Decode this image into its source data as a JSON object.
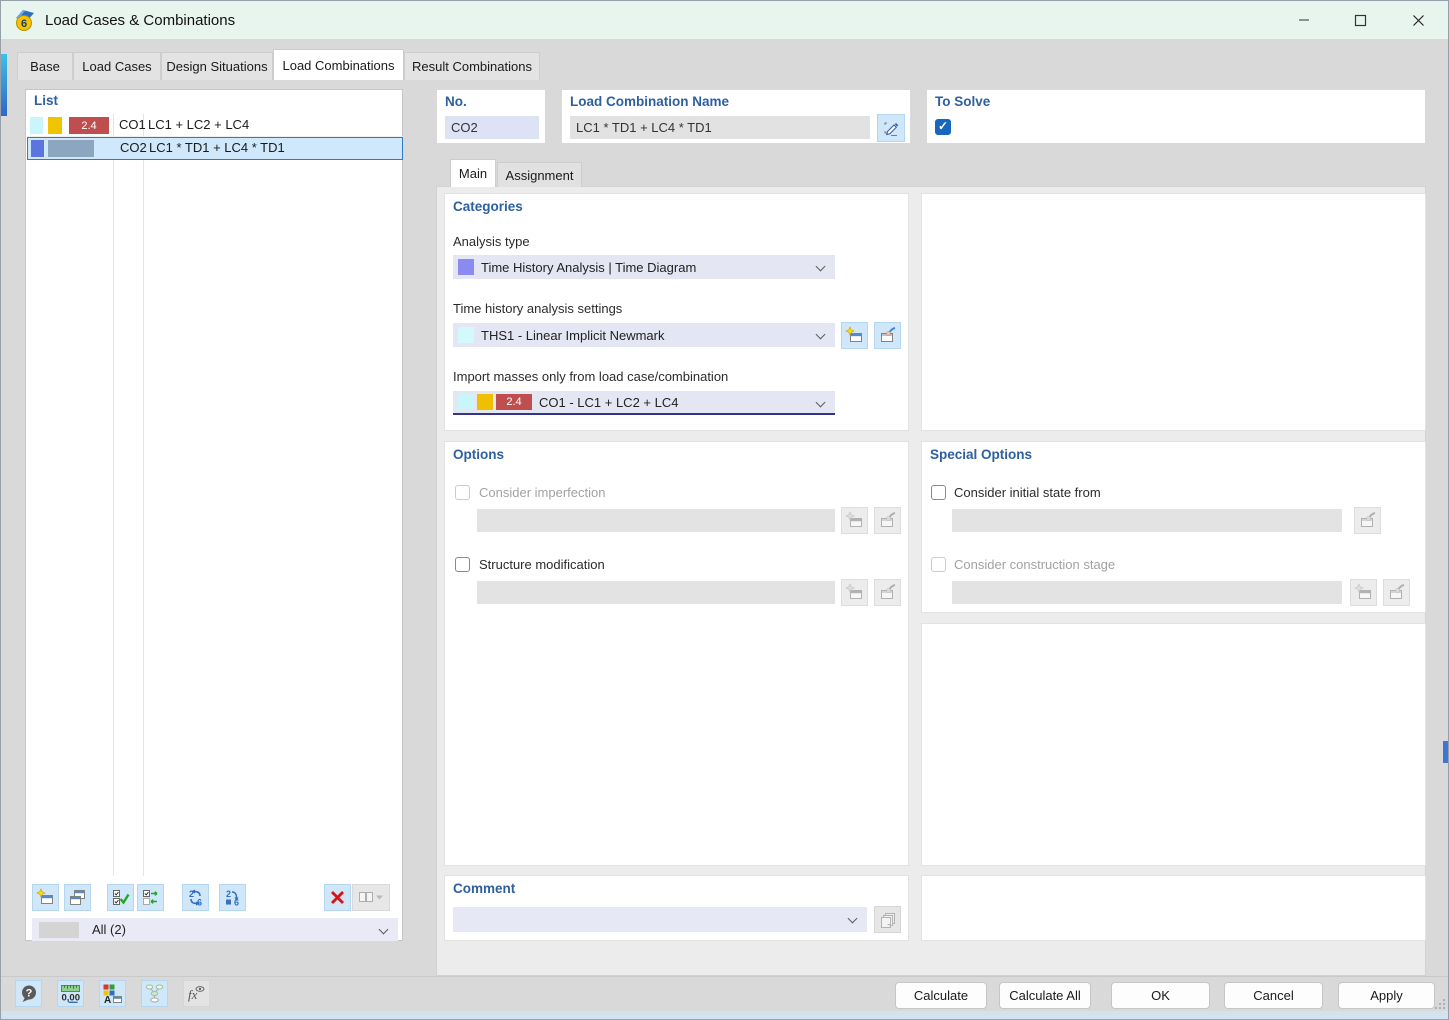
{
  "window": {
    "title": "Load Cases & Combinations"
  },
  "tabs": {
    "items": [
      {
        "label": "Base"
      },
      {
        "label": "Load Cases"
      },
      {
        "label": "Design Situations"
      },
      {
        "label": "Load Combinations"
      },
      {
        "label": "Result Combinations"
      }
    ],
    "active": "Load Combinations"
  },
  "list": {
    "title": "List",
    "rows": [
      {
        "no": "CO1",
        "name": "LC1 + LC2 + LC4",
        "factor_badge": "2.4",
        "selected": false
      },
      {
        "no": "CO2",
        "name": "LC1 * TD1 + LC4 * TD1",
        "selected": true
      }
    ],
    "filter_value": "All (2)"
  },
  "header": {
    "no_label": "No.",
    "no_value": "CO2",
    "name_label": "Load Combination Name",
    "name_value": "LC1 * TD1 + LC4 * TD1",
    "to_solve_label": "To Solve",
    "to_solve_checked": true
  },
  "subtabs": {
    "items": [
      {
        "label": "Main"
      },
      {
        "label": "Assignment"
      }
    ],
    "active": "Main"
  },
  "categories": {
    "title": "Categories",
    "analysis_type": {
      "label": "Analysis type",
      "value": "Time History Analysis | Time Diagram",
      "swatch_color": "#8a8af0"
    },
    "time_history_settings": {
      "label": "Time history analysis settings",
      "value": "THS1 - Linear Implicit Newmark",
      "swatch_color": "#d2fafd"
    },
    "import_masses": {
      "label": "Import masses only from load case/combination",
      "value": "CO1 - LC1 + LC2 + LC4",
      "factor_badge": "2.4"
    }
  },
  "options": {
    "title": "Options",
    "consider_imperfection": {
      "label": "Consider imperfection",
      "checked": false,
      "enabled": false
    },
    "structure_modification": {
      "label": "Structure modification",
      "checked": false,
      "enabled": true
    }
  },
  "special_options": {
    "title": "Special Options",
    "consider_initial_state": {
      "label": "Consider initial state from",
      "checked": false,
      "enabled": true
    },
    "consider_construction_stage": {
      "label": "Consider construction stage",
      "checked": false,
      "enabled": false
    }
  },
  "comment": {
    "title": "Comment",
    "value": ""
  },
  "footer": {
    "buttons": [
      {
        "label": "Calculate"
      },
      {
        "label": "Calculate All"
      },
      {
        "label": "OK"
      },
      {
        "label": "Cancel"
      },
      {
        "label": "Apply"
      }
    ]
  },
  "icons": {
    "units_text": "0,00",
    "renumber_from": "2",
    "renumber_to": "6",
    "help_glyph": "?"
  },
  "colors": {
    "titlebar": "#e8f5ee",
    "accent_blue": "#2e5f9e",
    "selection": "#cfe8fb",
    "checkbox_checked": "#1767c0",
    "badge_red": "#bf4e4e"
  }
}
